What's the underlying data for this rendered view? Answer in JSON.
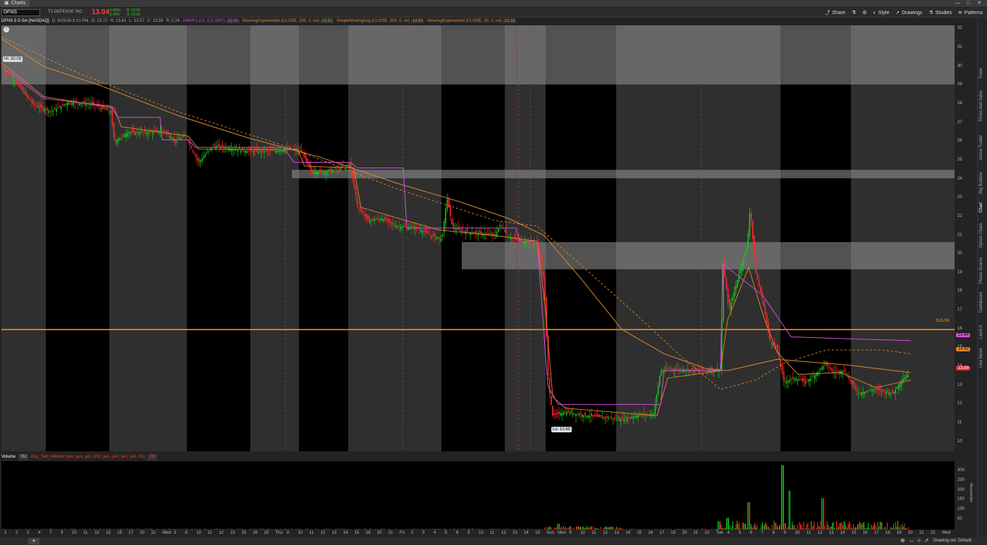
{
  "window": {
    "tab_label": "Charts"
  },
  "toolbar": {
    "symbol": "DFNS",
    "company": "T3 DEFENSE INC",
    "last": "13.04",
    "change_a": "-0.4554",
    "change_b": "-3.45%",
    "bid_ask": "B: 13.04",
    "ask": "A: 13.39",
    "buttons": [
      "Share",
      "Style",
      "Drawings",
      "Studies",
      "Patterns"
    ]
  },
  "info": {
    "title": "DFNS 5 D 5m [NASDAQ]",
    "date": "D: 8/25/26 9:10 PM",
    "open": "O: 13.72",
    "high": "H: 13.81",
    "low": "L: 13.57",
    "close": "C: 13.59",
    "range": "R: 0.24",
    "studies": [
      {
        "label": "VWAP (-2.0, 2.0, DAY)",
        "value": "15.44",
        "color": "#d34ed8"
      },
      {
        "label": "MovAvgExponential (CLOSE, 200, 0, no)",
        "value": "13.81",
        "color": "#e08a2e"
      },
      {
        "label": "SimpleMovingAvg (CLOSE, 200, 0, no)",
        "value": "14.62",
        "color": "#e08a2e"
      },
      {
        "label": "MovAvgExponential (CLOSE, 20, 0, no)",
        "value": "13.33",
        "color": "#e08a2e"
      }
    ]
  },
  "price_labels": {
    "hi": "Hi: 30.09",
    "lo": "Lo: 10.65",
    "level": "$15.99",
    "vwap": "15.44",
    "sma": "14.62",
    "last": "13.59"
  },
  "volume": {
    "title": "Volume",
    "value": "782",
    "study": "Buy_Sell_Volume (yes, yes, yes, 200, yes, yes, yes, yes, 50)",
    "study_value": "782",
    "unit": "<thousands>"
  },
  "yaxis_ticks": [
    "32",
    "31",
    "30",
    "29",
    "28",
    "27",
    "26",
    "25",
    "24",
    "23",
    "22",
    "21",
    "20",
    "19",
    "18",
    "17",
    "16",
    "15",
    "14",
    "13",
    "12",
    "11",
    "10"
  ],
  "vaxis_ticks": [
    "300",
    "250",
    "200",
    "150",
    "100",
    "50"
  ],
  "xaxis_ticks": [
    "1",
    "2",
    "3",
    "4",
    "7",
    "9",
    "10",
    "11",
    "12",
    "13",
    "15",
    "17",
    "20",
    "22",
    "Wed",
    "3",
    "8",
    "10",
    "11",
    "12",
    "13",
    "15",
    "16",
    "20",
    "Thu",
    "9",
    "10",
    "11",
    "12",
    "13",
    "14",
    "15",
    "16",
    "20",
    "21",
    "Fri",
    "2",
    "3",
    "4",
    "5",
    "6",
    "9",
    "10",
    "11",
    "12",
    "13",
    "14",
    "15",
    "Sun",
    "Mon",
    "9",
    "10",
    "11",
    "12",
    "13",
    "14",
    "15",
    "16",
    "17",
    "19",
    "20",
    "21",
    "22",
    "Tue",
    "4",
    "5",
    "6",
    "7",
    "8",
    "9",
    "10",
    "11",
    "12",
    "13",
    "14",
    "15",
    "16",
    "17",
    "18",
    "19",
    "20",
    "21",
    "22",
    "Wed"
  ],
  "right_tabs": [
    "Trade",
    "Times And Sales",
    "Active Trader",
    "Big Buttons",
    "Chart",
    "Option Chain",
    "Phase Scores",
    "Dashboard",
    "Level II",
    "Live News"
  ],
  "bottom": {
    "drawing_set": "Drawing set: Default"
  },
  "colors": {
    "up": "#19c819",
    "down": "#ff2a2a",
    "vwap": "#d34ed8",
    "ema": "#e08a2e",
    "level": "#ff8c1a"
  },
  "chart_data": {
    "type": "candlestick",
    "ylim": [
      9.5,
      32.2
    ],
    "resistance_line": 15.99,
    "zones": [
      [
        29.05,
        32.2
      ],
      [
        24.05,
        24.5
      ],
      [
        19.2,
        20.65
      ]
    ],
    "close_path": [
      [
        0,
        30.0
      ],
      [
        20,
        29.2
      ],
      [
        45,
        28.0
      ],
      [
        70,
        27.6
      ],
      [
        95,
        28.1
      ],
      [
        130,
        28.0
      ],
      [
        155,
        27.6
      ],
      [
        160,
        26.0
      ],
      [
        180,
        26.5
      ],
      [
        210,
        26.5
      ],
      [
        230,
        26.6
      ],
      [
        245,
        26.1
      ],
      [
        262,
        26.3
      ],
      [
        270,
        25.6
      ],
      [
        280,
        24.9
      ],
      [
        300,
        25.8
      ],
      [
        330,
        25.6
      ],
      [
        350,
        25.5
      ],
      [
        380,
        25.5
      ],
      [
        410,
        25.6
      ],
      [
        425,
        25.5
      ],
      [
        440,
        24.4
      ],
      [
        460,
        24.4
      ],
      [
        480,
        24.6
      ],
      [
        495,
        24.8
      ],
      [
        505,
        22.6
      ],
      [
        520,
        21.8
      ],
      [
        540,
        21.9
      ],
      [
        560,
        21.5
      ],
      [
        590,
        21.4
      ],
      [
        610,
        21.0
      ],
      [
        625,
        20.8
      ],
      [
        632,
        23.0
      ],
      [
        640,
        21.4
      ],
      [
        660,
        21.2
      ],
      [
        680,
        21.1
      ],
      [
        700,
        21.0
      ],
      [
        708,
        21.6
      ],
      [
        720,
        20.9
      ],
      [
        740,
        20.7
      ],
      [
        760,
        20.6
      ],
      [
        770,
        18.5
      ],
      [
        776,
        13.0
      ],
      [
        782,
        11.4
      ],
      [
        800,
        11.6
      ],
      [
        830,
        11.4
      ],
      [
        860,
        11.3
      ],
      [
        880,
        11.2
      ],
      [
        900,
        11.4
      ],
      [
        925,
        11.5
      ],
      [
        935,
        13.8
      ],
      [
        950,
        13.9
      ],
      [
        1000,
        13.8
      ],
      [
        1020,
        13.9
      ],
      [
        1024,
        19.5
      ],
      [
        1032,
        17.0
      ],
      [
        1045,
        18.8
      ],
      [
        1058,
        20.5
      ],
      [
        1062,
        22.5
      ],
      [
        1070,
        19.0
      ],
      [
        1080,
        17.5
      ],
      [
        1090,
        15.4
      ],
      [
        1100,
        15.0
      ],
      [
        1110,
        13.2
      ],
      [
        1125,
        13.4
      ],
      [
        1140,
        13.2
      ],
      [
        1155,
        13.6
      ],
      [
        1168,
        14.2
      ],
      [
        1180,
        13.7
      ],
      [
        1195,
        13.8
      ],
      [
        1215,
        12.6
      ],
      [
        1240,
        12.8
      ],
      [
        1265,
        12.6
      ],
      [
        1275,
        13.2
      ],
      [
        1285,
        13.6
      ]
    ],
    "vwap_path": [
      [
        0,
        30
      ],
      [
        60,
        28.3
      ],
      [
        155,
        27.9
      ],
      [
        165,
        27.3
      ],
      [
        225,
        27.3
      ],
      [
        228,
        26.1
      ],
      [
        265,
        26.1
      ],
      [
        275,
        25.7
      ],
      [
        400,
        25.7
      ],
      [
        415,
        24.9
      ],
      [
        495,
        24.9
      ],
      [
        505,
        24.6
      ],
      [
        570,
        24.6
      ],
      [
        575,
        21.4
      ],
      [
        730,
        21.4
      ],
      [
        735,
        20.7
      ],
      [
        760,
        20.7
      ],
      [
        775,
        13.0
      ],
      [
        790,
        12.0
      ],
      [
        870,
        12.0
      ],
      [
        935,
        12.0
      ],
      [
        940,
        13.8
      ],
      [
        1000,
        13.8
      ],
      [
        1020,
        13.8
      ],
      [
        1023,
        19.5
      ],
      [
        1080,
        17.8
      ],
      [
        1120,
        15.6
      ],
      [
        1200,
        15.5
      ],
      [
        1290,
        15.4
      ]
    ],
    "ema200_path": [
      [
        0,
        31.5
      ],
      [
        60,
        30.0
      ],
      [
        140,
        29.0
      ],
      [
        250,
        27.4
      ],
      [
        350,
        26.2
      ],
      [
        450,
        25.2
      ],
      [
        560,
        23.8
      ],
      [
        650,
        22.8
      ],
      [
        720,
        21.9
      ],
      [
        770,
        21.0
      ],
      [
        820,
        18.8
      ],
      [
        880,
        16.0
      ],
      [
        940,
        14.7
      ],
      [
        1000,
        13.9
      ],
      [
        1030,
        13.8
      ],
      [
        1100,
        14.4
      ],
      [
        1200,
        14.1
      ],
      [
        1290,
        13.7
      ]
    ],
    "sma_path": [
      [
        0,
        31.6
      ],
      [
        100,
        29.8
      ],
      [
        250,
        27.6
      ],
      [
        400,
        25.8
      ],
      [
        560,
        23.5
      ],
      [
        700,
        21.8
      ],
      [
        760,
        21.5
      ],
      [
        820,
        19.5
      ],
      [
        900,
        16.8
      ],
      [
        960,
        14.7
      ],
      [
        1020,
        12.8
      ],
      [
        1070,
        13.3
      ],
      [
        1110,
        14.2
      ],
      [
        1170,
        14.9
      ],
      [
        1250,
        14.9
      ],
      [
        1290,
        14.7
      ]
    ],
    "ema20_path": [
      [
        0,
        30.2
      ],
      [
        60,
        28.4
      ],
      [
        160,
        27.8
      ],
      [
        170,
        26.8
      ],
      [
        265,
        26.3
      ],
      [
        280,
        25.6
      ],
      [
        420,
        25.6
      ],
      [
        430,
        24.7
      ],
      [
        500,
        24.6
      ],
      [
        510,
        22.5
      ],
      [
        620,
        21.3
      ],
      [
        700,
        21.0
      ],
      [
        760,
        20.7
      ],
      [
        772,
        17.0
      ],
      [
        782,
        12.4
      ],
      [
        800,
        11.8
      ],
      [
        930,
        11.4
      ],
      [
        945,
        13.4
      ],
      [
        1020,
        13.8
      ],
      [
        1030,
        16.5
      ],
      [
        1060,
        19.3
      ],
      [
        1080,
        16.8
      ],
      [
        1100,
        14.8
      ],
      [
        1130,
        13.6
      ],
      [
        1190,
        13.7
      ],
      [
        1240,
        12.9
      ],
      [
        1290,
        13.3
      ]
    ],
    "session_bands": [
      [
        0,
        63,
        "#2f2f2f"
      ],
      [
        63,
        153,
        "#000"
      ],
      [
        153,
        263,
        "#2f2f2f"
      ],
      [
        263,
        353,
        "#000"
      ],
      [
        353,
        422,
        "#2f2f2f"
      ],
      [
        422,
        492,
        "#000"
      ],
      [
        492,
        624,
        "#2f2f2f"
      ],
      [
        624,
        714,
        "#000"
      ],
      [
        714,
        772,
        "#2f2f2f"
      ],
      [
        772,
        872,
        "#000"
      ],
      [
        872,
        1105,
        "#2f2f2f"
      ],
      [
        1105,
        1205,
        "#000"
      ],
      [
        1205,
        1352,
        "#2f2f2f"
      ]
    ],
    "volume_peaks": [
      [
        1108,
        330
      ],
      [
        1060,
        140
      ],
      [
        1118,
        200
      ],
      [
        1165,
        160
      ],
      [
        1030,
        60
      ],
      [
        790,
        30
      ]
    ]
  }
}
